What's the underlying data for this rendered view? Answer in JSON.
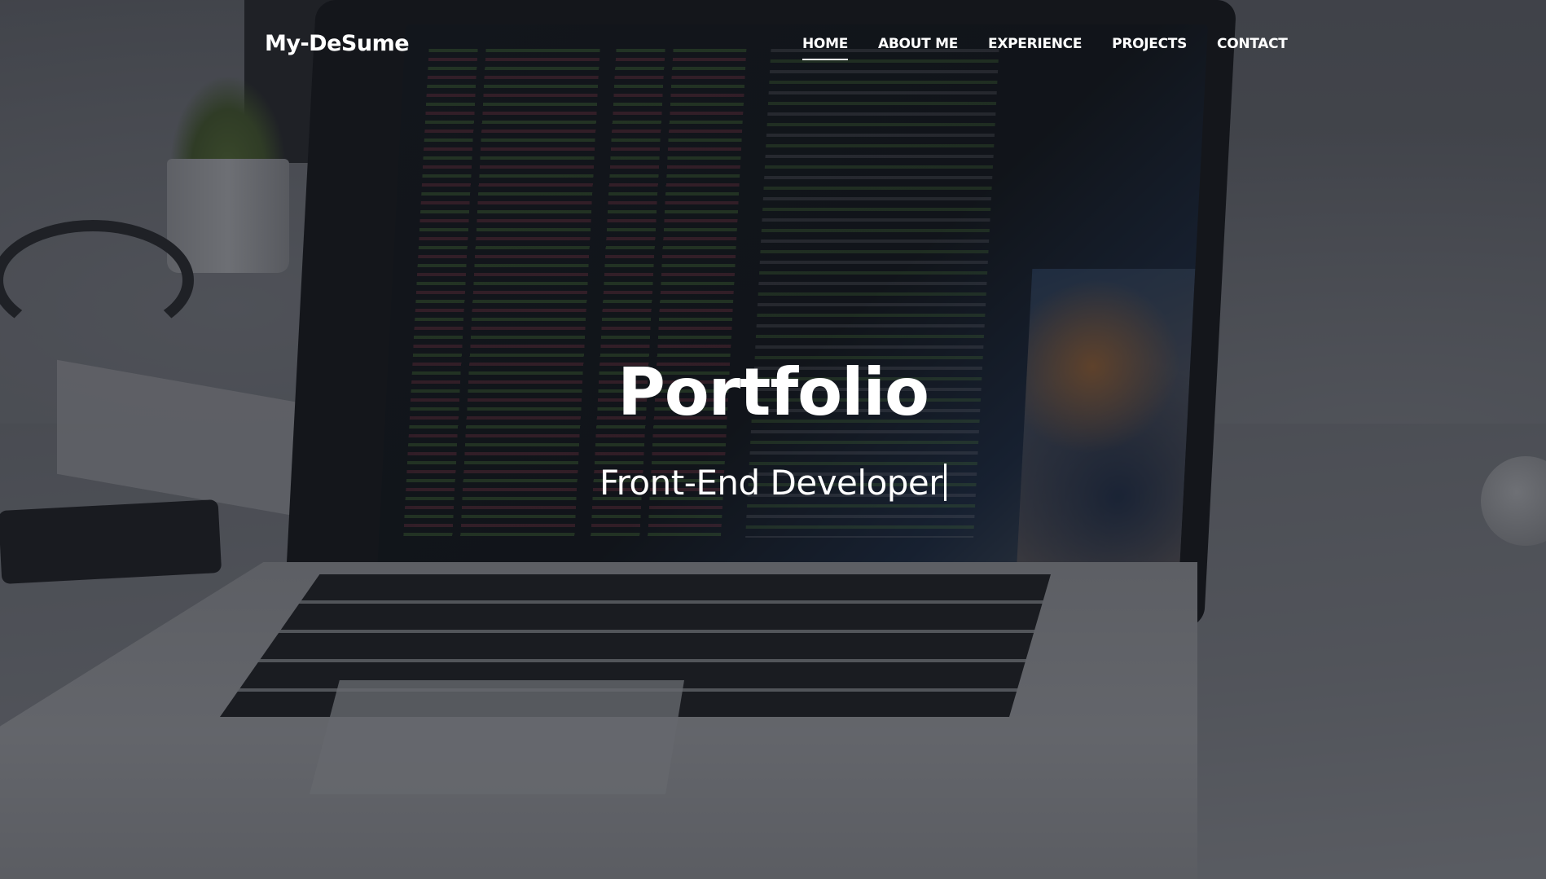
{
  "navbar": {
    "brand": "My-DeSume",
    "links": [
      {
        "label": "HOME",
        "active": true
      },
      {
        "label": "ABOUT ME",
        "active": false
      },
      {
        "label": "EXPERIENCE",
        "active": false
      },
      {
        "label": "PROJECTS",
        "active": false
      },
      {
        "label": "CONTACT",
        "active": false
      }
    ]
  },
  "hero": {
    "title": "Portfolio",
    "subtitle": "Front-End Developer",
    "background_subject": "laptop-with-code-editor-on-desk"
  },
  "colors": {
    "text": "#ffffff",
    "overlay": "#14161c"
  }
}
